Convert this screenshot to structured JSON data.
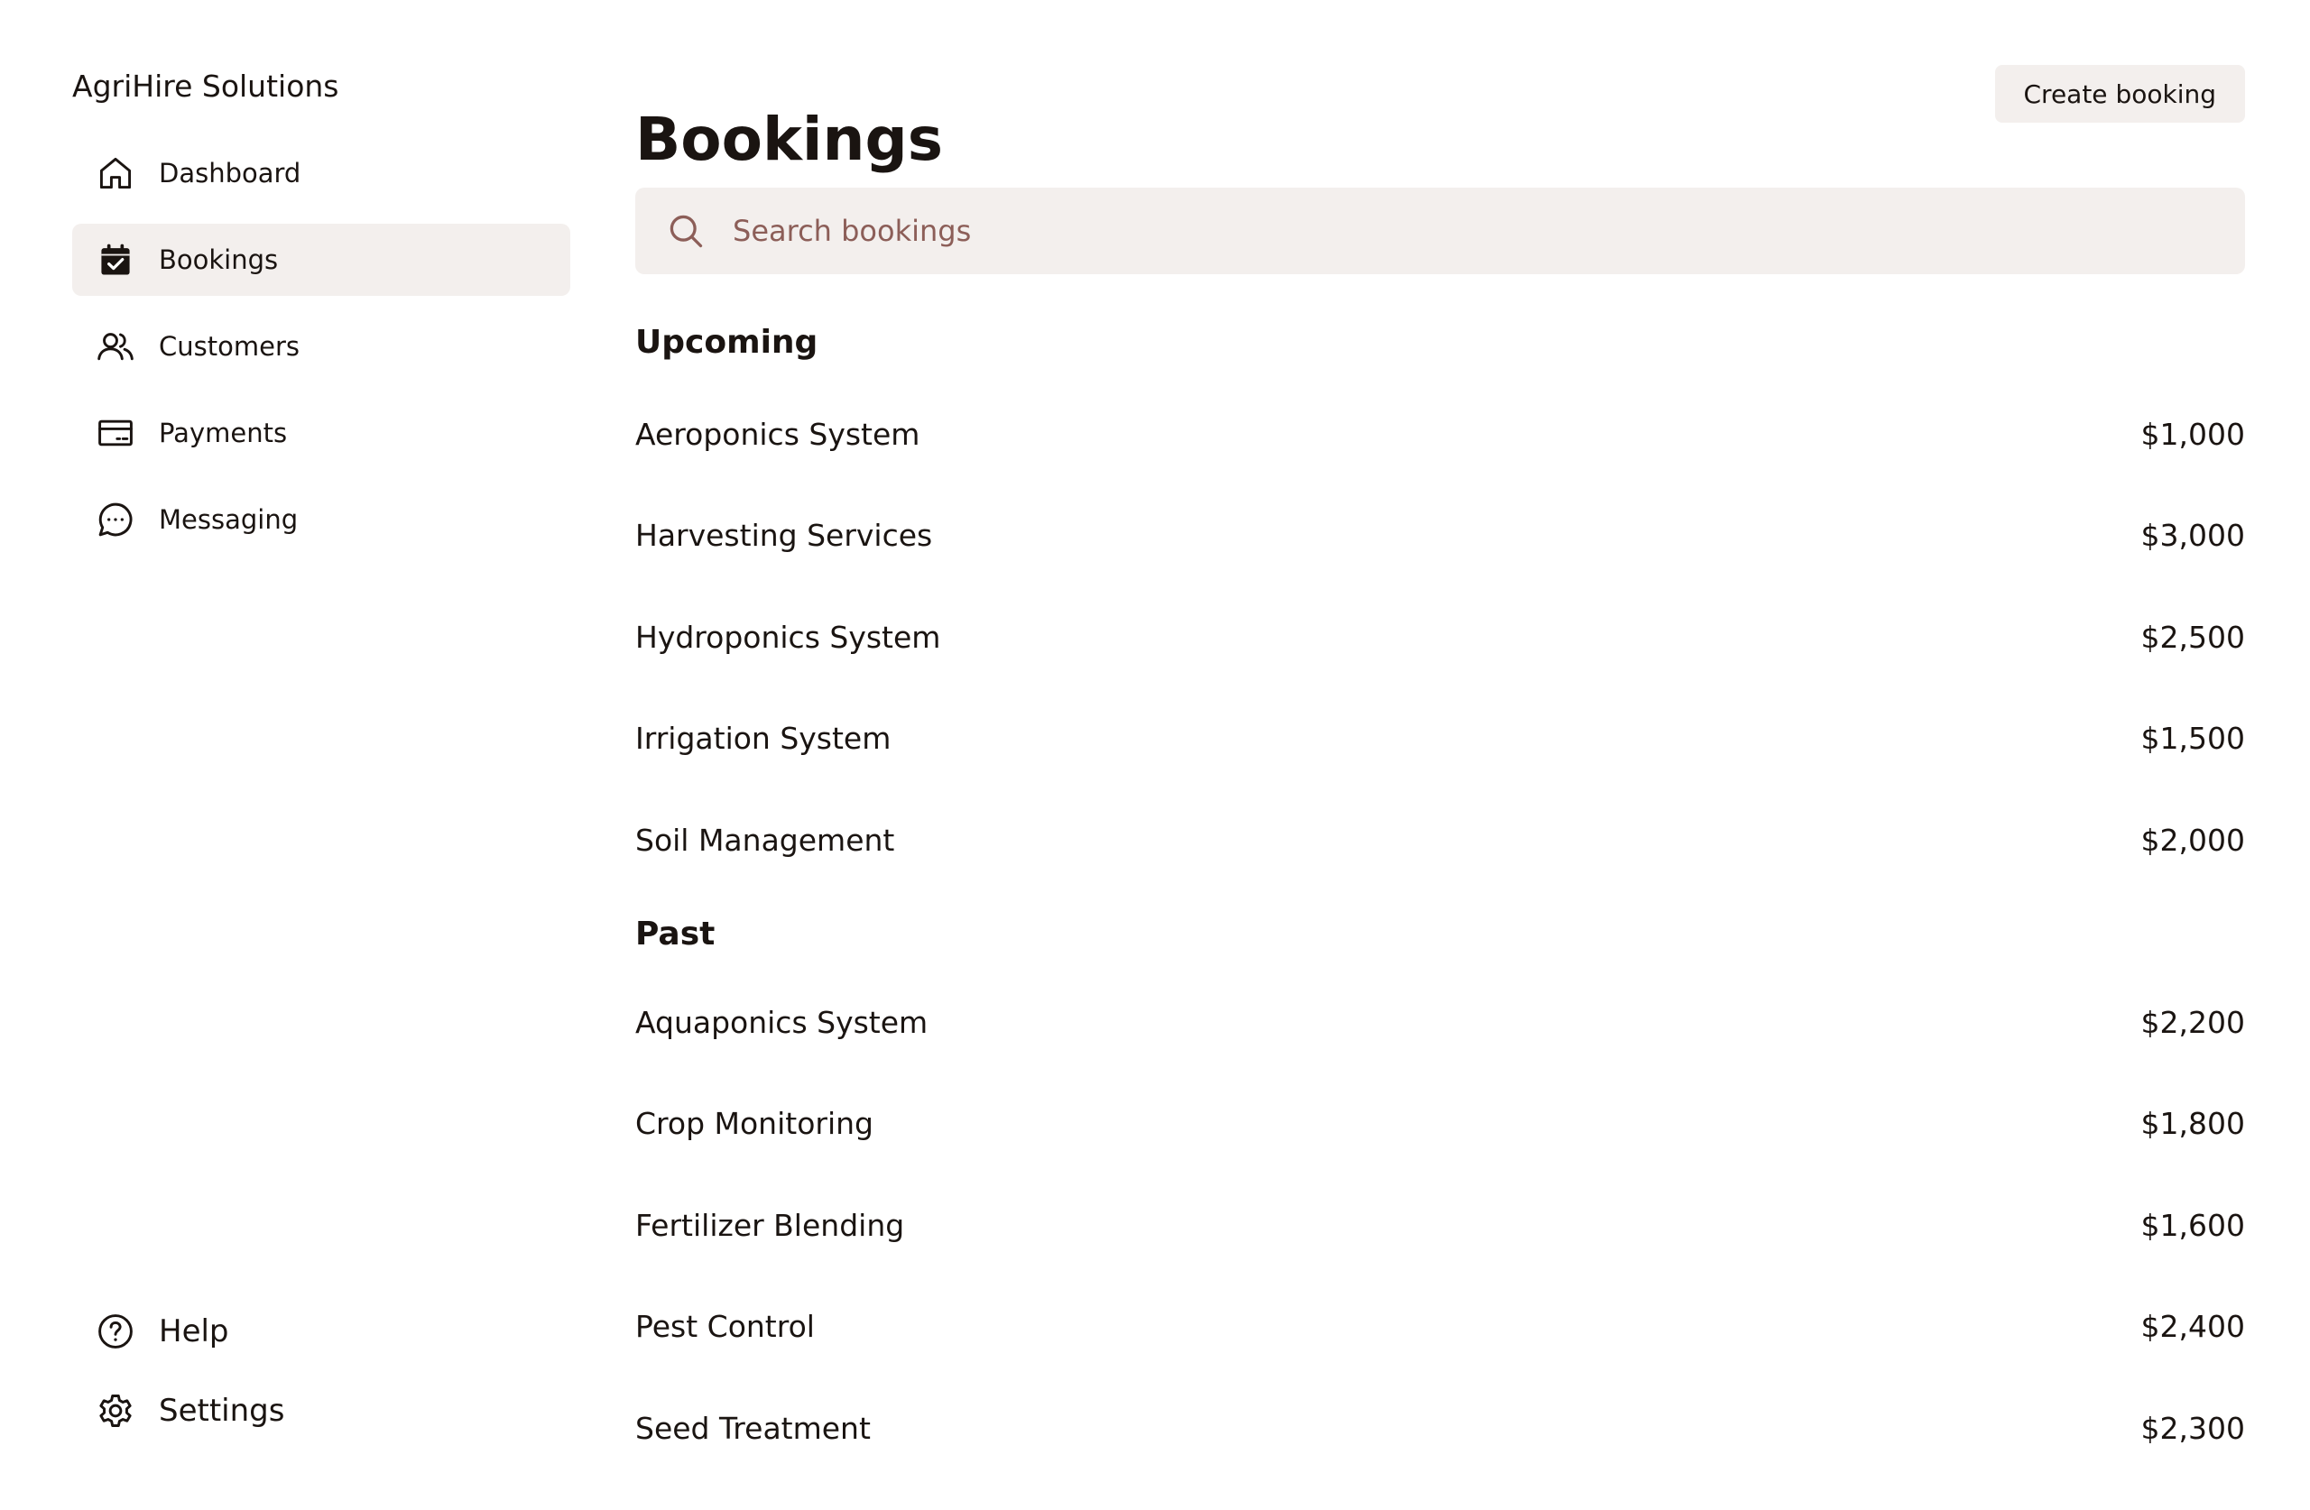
{
  "app": {
    "name": "AgriHire Solutions"
  },
  "sidebar": {
    "items": [
      {
        "label": "Dashboard",
        "icon": "home-icon",
        "active": false
      },
      {
        "label": "Bookings",
        "icon": "calendar-check-icon",
        "active": true
      },
      {
        "label": "Customers",
        "icon": "users-icon",
        "active": false
      },
      {
        "label": "Payments",
        "icon": "credit-card-icon",
        "active": false
      },
      {
        "label": "Messaging",
        "icon": "chat-bubble-icon",
        "active": false
      }
    ],
    "bottom_items": [
      {
        "label": "Help",
        "icon": "question-circle-icon"
      },
      {
        "label": "Settings",
        "icon": "gear-icon"
      }
    ]
  },
  "header": {
    "title": "Bookings",
    "create_button_label": "Create booking"
  },
  "search": {
    "placeholder": "Search bookings",
    "value": ""
  },
  "sections": {
    "upcoming": {
      "heading": "Upcoming",
      "rows": [
        {
          "name": "Aeroponics System",
          "price": "$1,000"
        },
        {
          "name": "Harvesting Services",
          "price": "$3,000"
        },
        {
          "name": "Hydroponics System",
          "price": "$2,500"
        },
        {
          "name": "Irrigation System",
          "price": "$1,500"
        },
        {
          "name": "Soil Management",
          "price": "$2,000"
        }
      ]
    },
    "past": {
      "heading": "Past",
      "rows": [
        {
          "name": "Aquaponics System",
          "price": "$2,200"
        },
        {
          "name": "Crop Monitoring",
          "price": "$1,800"
        },
        {
          "name": "Fertilizer Blending",
          "price": "$1,600"
        },
        {
          "name": "Pest Control",
          "price": "$2,400"
        },
        {
          "name": "Seed Treatment",
          "price": "$2,300"
        }
      ]
    }
  },
  "colors": {
    "active_background": "#f3efed",
    "text": "#1a1411",
    "muted": "#8c5e58"
  }
}
